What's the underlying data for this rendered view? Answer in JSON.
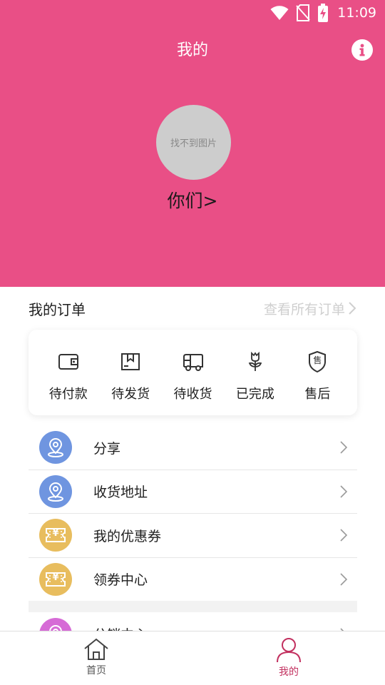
{
  "status_bar": {
    "time": "11:09"
  },
  "header": {
    "title": "我的",
    "avatar_placeholder": "找不到图片",
    "username": "你们>"
  },
  "orders": {
    "title": "我的订单",
    "view_all": "查看所有订单",
    "items": [
      {
        "label": "待付款",
        "icon": "wallet-icon"
      },
      {
        "label": "待发货",
        "icon": "package-icon"
      },
      {
        "label": "待收货",
        "icon": "truck-icon"
      },
      {
        "label": "已完成",
        "icon": "flower-icon"
      },
      {
        "label": "售后",
        "icon": "after-sales-shield-icon"
      }
    ],
    "after_sales_glyph": "售"
  },
  "menu": {
    "items": [
      {
        "label": "分享",
        "icon": "location-pin-icon",
        "color": "#6f95e0"
      },
      {
        "label": "收货地址",
        "icon": "location-pin-icon",
        "color": "#6f95e0"
      },
      {
        "label": "我的优惠券",
        "icon": "coupon-icon",
        "color": "#e8bd5e"
      },
      {
        "label": "领券中心",
        "icon": "coupon-icon",
        "color": "#e8bd5e"
      },
      {
        "label": "分销中心",
        "icon": "location-pin-icon",
        "color": "#d66bd6"
      }
    ],
    "coupon_glyph": "¥"
  },
  "tabbar": {
    "tabs": [
      {
        "label": "首页",
        "icon": "home-icon",
        "active": false
      },
      {
        "label": "我的",
        "icon": "profile-icon",
        "active": true
      }
    ]
  },
  "colors": {
    "brand": "#e94f86",
    "active_tab": "#c2305f",
    "inactive_tab": "#555555"
  }
}
